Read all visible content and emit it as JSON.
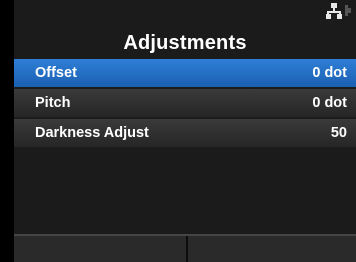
{
  "header": {
    "title": "Adjustments",
    "status_icon": "network-icon"
  },
  "menu": {
    "items": [
      {
        "label": "Offset",
        "value": "0 dot",
        "selected": true
      },
      {
        "label": "Pitch",
        "value": "0 dot",
        "selected": false
      },
      {
        "label": "Darkness Adjust",
        "value": "50",
        "selected": false
      }
    ]
  },
  "colors": {
    "background": "#1b1b1b",
    "row": "#2e2e2e",
    "selected": "#2a71c6",
    "text": "#ffffff"
  }
}
